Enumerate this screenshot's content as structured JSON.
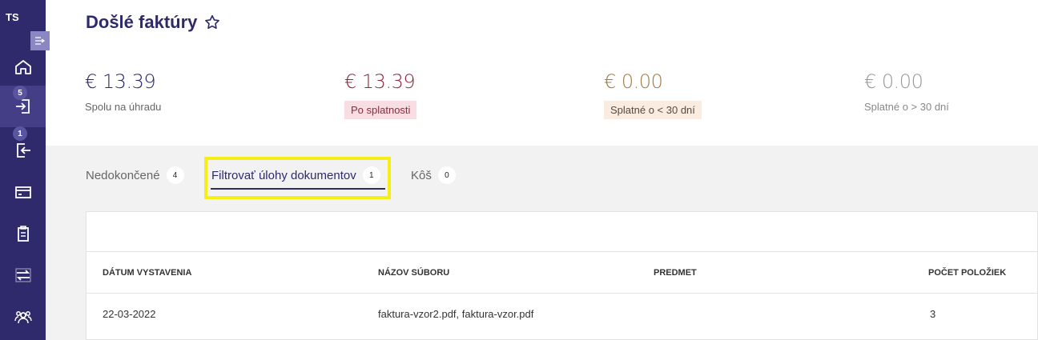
{
  "sidebar": {
    "logo": "TS",
    "badges": {
      "incoming": "5",
      "outgoing": "1"
    }
  },
  "header": {
    "title": "Došlé faktúry"
  },
  "summary": [
    {
      "amount": "€ 13.39",
      "label": "Spolu na úhradu"
    },
    {
      "amount": "€ 13.39",
      "label": "Po splatnosti"
    },
    {
      "amount": "€ 0.00",
      "label": "Splatné o < 30 dní"
    },
    {
      "amount": "€ 0.00",
      "label": "Splatné o > 30 dní"
    }
  ],
  "tabs": [
    {
      "label": "Nedokončené",
      "count": "4"
    },
    {
      "label": "Filtrovať úlohy dokumentov",
      "count": "1"
    },
    {
      "label": "Kôš",
      "count": "0"
    }
  ],
  "table": {
    "columns": [
      "DÁTUM VYSTAVENIA",
      "NÁZOV SÚBORU",
      "PREDMET",
      "POČET POLOŽIEK"
    ],
    "rows": [
      [
        "22-03-2022",
        "faktura-vzor2.pdf, faktura-vzor.pdf",
        "",
        "3"
      ]
    ]
  },
  "colors": {
    "brand": "#2e2a6b",
    "overdue": "#8b2c3e",
    "due_soon": "#a07d46",
    "highlight": "#f5ef17"
  }
}
